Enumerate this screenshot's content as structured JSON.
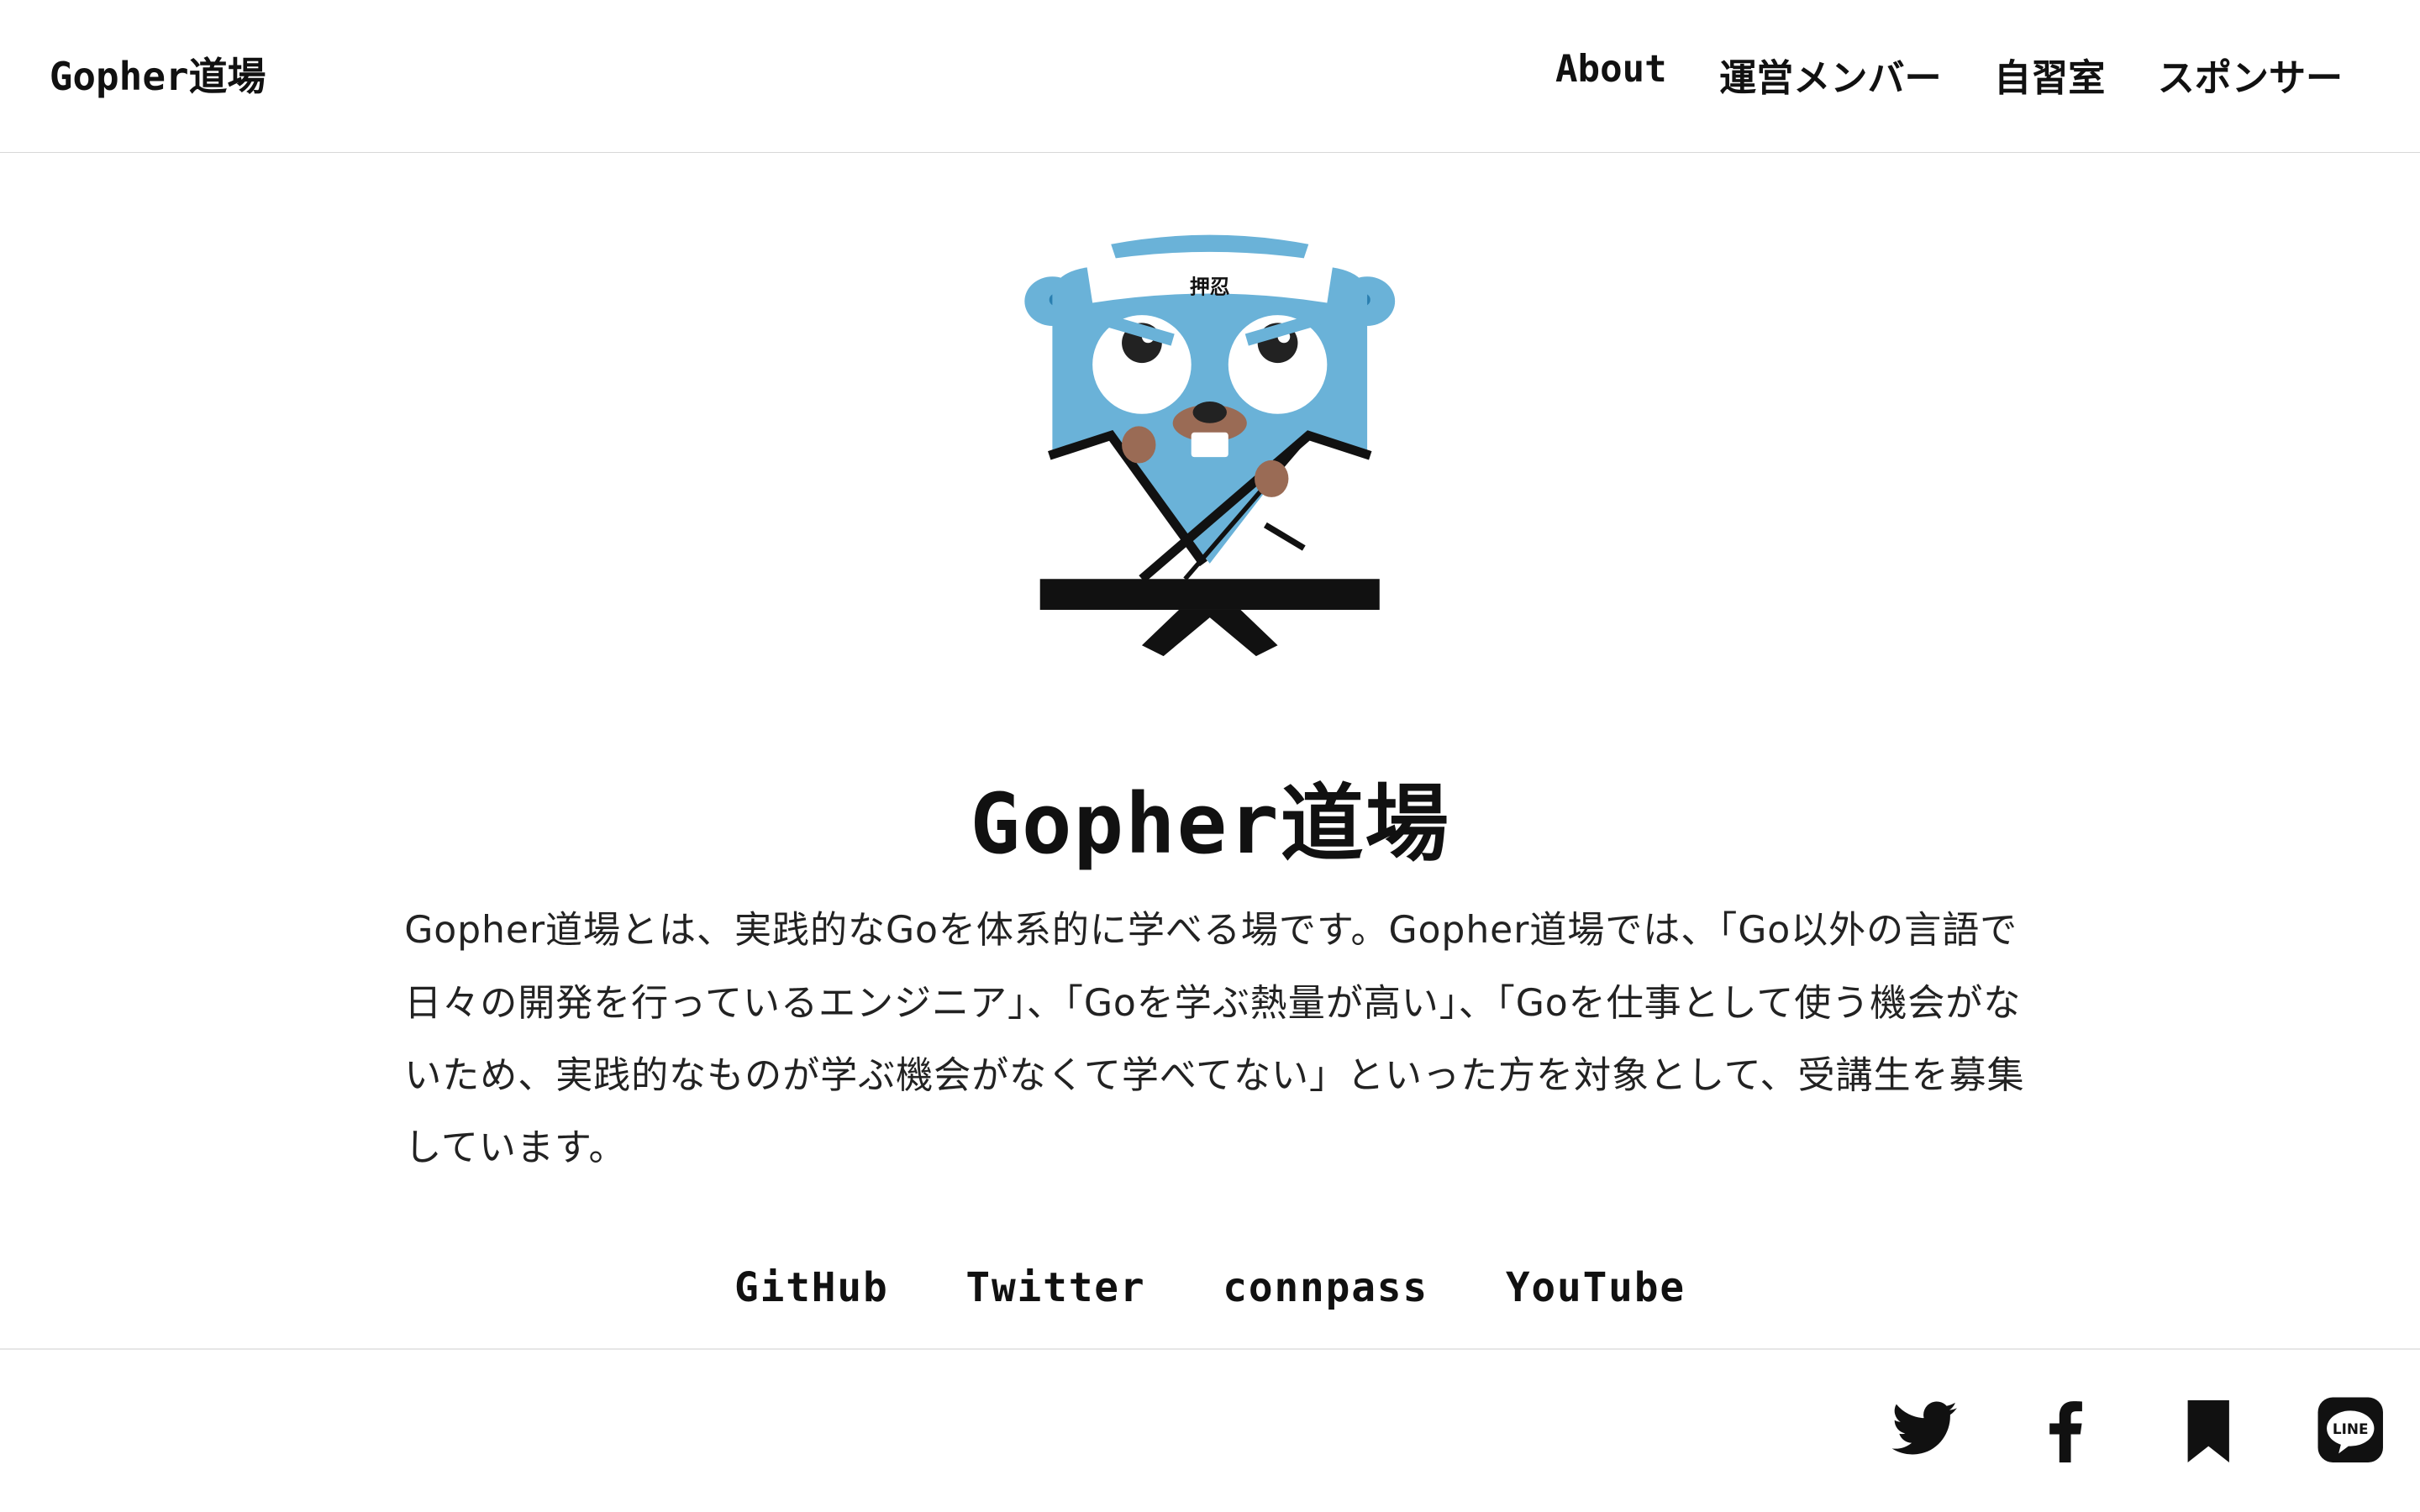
{
  "header": {
    "logo": "Gopher道場",
    "nav": [
      "About",
      "運営メンバー",
      "自習室",
      "スポンサー"
    ]
  },
  "mascot": {
    "headband_text": "押忍",
    "colors": {
      "body": "#6ab2d8",
      "belt": "#111111",
      "nose": "#9a6b55"
    }
  },
  "main": {
    "title": "Gopher道場",
    "description": "Gopher道場とは、実践的なGoを体系的に学べる場です。Gopher道場では、「Go以外の言語で日々の開発を行っているエンジニア」、「Goを学ぶ熱量が高い」、「Goを仕事として使う機会がないため、実践的なものが学ぶ機会がなくて学べてない」といった方を対象として、受講生を募集しています。"
  },
  "links": [
    "GitHub",
    "Twitter",
    "connpass",
    "YouTube"
  ],
  "share_icons": [
    "twitter-icon",
    "facebook-icon",
    "bookmark-icon",
    "line-icon"
  ]
}
